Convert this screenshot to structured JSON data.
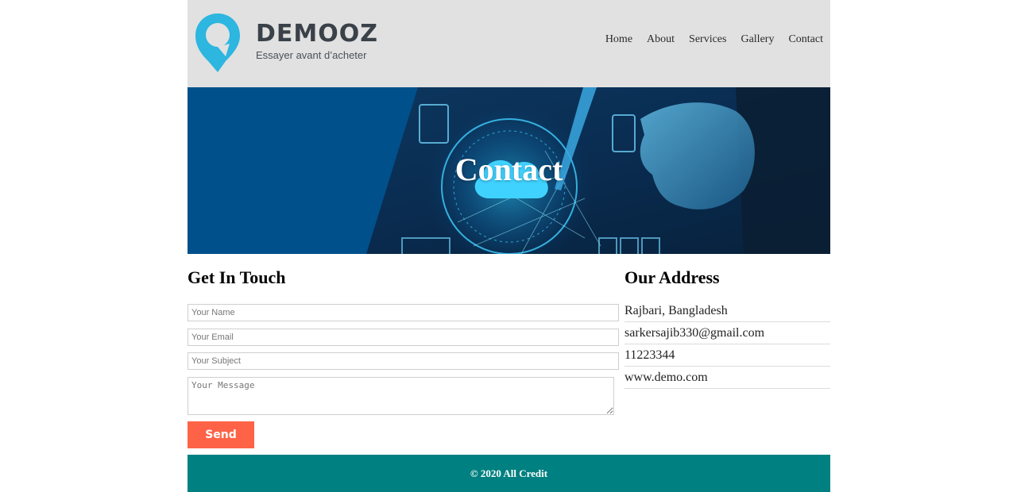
{
  "brand": {
    "name": "DEMOOZ",
    "tagline": "Essayer avant d’acheter",
    "icon": "map-pin-logo",
    "color": "#2cb6e0"
  },
  "nav": {
    "items": [
      {
        "label": "Home"
      },
      {
        "label": "About"
      },
      {
        "label": "Services"
      },
      {
        "label": "Gallery"
      },
      {
        "label": "Contact"
      }
    ]
  },
  "hero": {
    "title": "Contact"
  },
  "contact_form": {
    "title": "Get In Touch",
    "name_placeholder": "Your Name",
    "email_placeholder": "Your Email",
    "subject_placeholder": "Your Subject",
    "message_placeholder": "Your Message",
    "send_label": "Send",
    "send_color": "#ff6347"
  },
  "address": {
    "title": "Our Address",
    "lines": [
      "Rajbari, Bangladesh",
      "sarkersajib330@gmail.com",
      "11223344",
      "www.demo.com"
    ]
  },
  "footer": {
    "text": "© 2020 All Credit",
    "color": "#008080"
  }
}
